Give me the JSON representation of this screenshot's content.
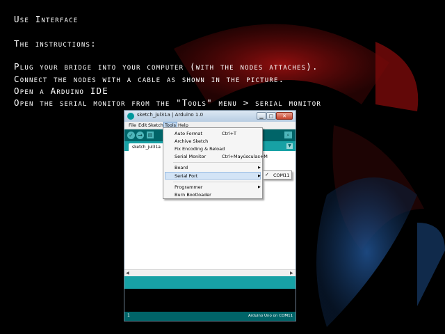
{
  "slide": {
    "title": "Use Interface",
    "subtitle": "The instructions:",
    "lines": [
      "Plug your bridge into your computer (with the nodes attaches).",
      "Connect the nodes with a cable as shown in the picture.",
      "Open a Arduino IDE",
      "Open the serial monitor from the \"Tools\" menu > serial monitor"
    ]
  },
  "window": {
    "title": "sketch_jul31a | Arduino 1.0",
    "menu": [
      "File",
      "Edit",
      "Sketch",
      "Tools",
      "Help"
    ],
    "tab": "sketch_jul31a",
    "footer_line": "1",
    "footer_board": "Arduino Uno on COM11"
  },
  "tools_menu": {
    "auto_format": "Auto Format",
    "auto_format_shortcut": "Ctrl+T",
    "archive_sketch": "Archive Sketch",
    "fix_encoding": "Fix Encoding & Reload",
    "serial_monitor": "Serial Monitor",
    "serial_monitor_shortcut": "Ctrl+Mayúsculas+M",
    "board": "Board",
    "serial_port": "Serial Port",
    "programmer": "Programmer",
    "burn_bootloader": "Burn Bootloader"
  },
  "serial_submenu": {
    "port": "COM11"
  }
}
